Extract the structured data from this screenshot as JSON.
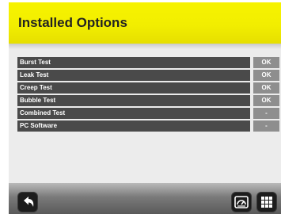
{
  "header": {
    "title": "Installed Options"
  },
  "options": [
    {
      "name": "Burst Test",
      "status": "OK"
    },
    {
      "name": "Leak Test",
      "status": "OK"
    },
    {
      "name": "Creep Test",
      "status": "OK"
    },
    {
      "name": "Bubble Test",
      "status": "OK"
    },
    {
      "name": "Combined Test",
      "status": "-"
    },
    {
      "name": "PC Software",
      "status": "-"
    }
  ],
  "footer": {
    "back_icon": "back-arrow-icon",
    "gauge_icon": "gauge-icon",
    "grid_icon": "grid-menu-icon"
  },
  "colors": {
    "header_yellow": "#f2ee00",
    "row_dark": "#4a4a4a",
    "status_gray": "#8e8e8e"
  }
}
